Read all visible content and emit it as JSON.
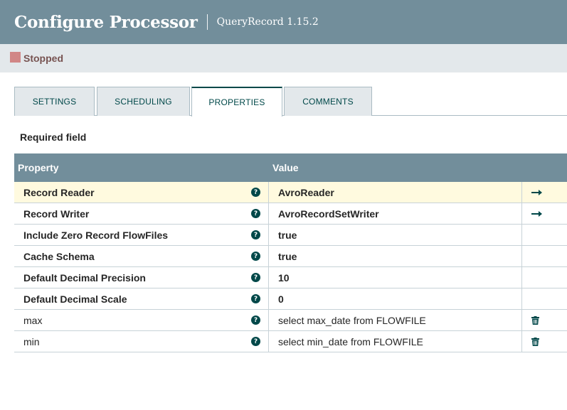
{
  "header": {
    "title": "Configure Processor",
    "subtitle": "QueryRecord 1.15.2"
  },
  "status": {
    "label": "Stopped",
    "color": "#d18686"
  },
  "tabs": [
    {
      "label": "SETTINGS",
      "active": false
    },
    {
      "label": "SCHEDULING",
      "active": false
    },
    {
      "label": "PROPERTIES",
      "active": true
    },
    {
      "label": "COMMENTS",
      "active": false
    }
  ],
  "required_label": "Required field",
  "grid": {
    "columns": [
      "Property",
      "Value"
    ],
    "rows": [
      {
        "property": "Record Reader",
        "value": "AvroReader",
        "required": true,
        "action": "arrow-right-icon",
        "selected": true
      },
      {
        "property": "Record Writer",
        "value": "AvroRecordSetWriter",
        "required": true,
        "action": "arrow-right-icon",
        "selected": false
      },
      {
        "property": "Include Zero Record FlowFiles",
        "value": "true",
        "required": true,
        "action": "",
        "selected": false
      },
      {
        "property": "Cache Schema",
        "value": "true",
        "required": true,
        "action": "",
        "selected": false
      },
      {
        "property": "Default Decimal Precision",
        "value": "10",
        "required": true,
        "action": "",
        "selected": false
      },
      {
        "property": "Default Decimal Scale",
        "value": "0",
        "required": true,
        "action": "",
        "selected": false
      },
      {
        "property": "max",
        "value": "select max_date from FLOWFILE",
        "required": false,
        "action": "trash-icon",
        "selected": false
      },
      {
        "property": "min",
        "value": "select min_date from FLOWFILE",
        "required": false,
        "action": "trash-icon",
        "selected": false
      }
    ]
  },
  "help_glyph": "?",
  "colors": {
    "header_bg": "#728e9b",
    "accent": "#004849",
    "selected_row": "#fffadf"
  }
}
